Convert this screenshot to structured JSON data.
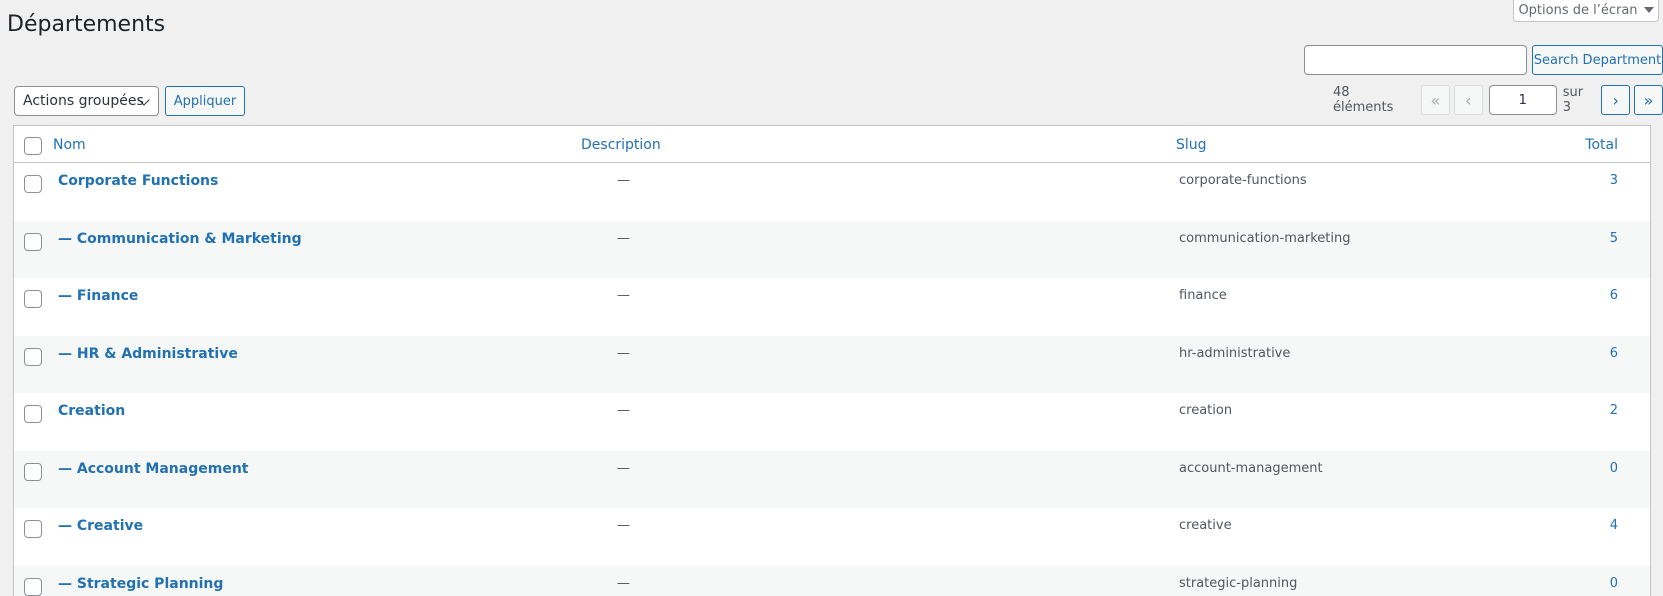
{
  "screen_options": {
    "label": "Options de l’écran"
  },
  "page": {
    "title": "Départements"
  },
  "search": {
    "value": "",
    "button_label": "Search Department"
  },
  "bulk": {
    "selected": "Actions groupées",
    "apply_label": "Appliquer"
  },
  "pagination": {
    "count_label": "48 éléments",
    "first": "«",
    "prev": "‹",
    "current_page": "1",
    "of_label": "sur 3",
    "next": "›",
    "last": "»"
  },
  "table": {
    "headers": {
      "name": "Nom",
      "description": "Description",
      "slug": "Slug",
      "total": "Total"
    },
    "rows": [
      {
        "name": "Corporate Functions",
        "description": "—",
        "slug": "corporate-functions",
        "total": "3"
      },
      {
        "name": "— Communication & Marketing",
        "description": "—",
        "slug": "communication-marketing",
        "total": "5"
      },
      {
        "name": "— Finance",
        "description": "—",
        "slug": "finance",
        "total": "6"
      },
      {
        "name": "— HR & Administrative",
        "description": "—",
        "slug": "hr-administrative",
        "total": "6"
      },
      {
        "name": "Creation",
        "description": "—",
        "slug": "creation",
        "total": "2"
      },
      {
        "name": "— Account Management",
        "description": "—",
        "slug": "account-management",
        "total": "0"
      },
      {
        "name": "— Creative",
        "description": "—",
        "slug": "creative",
        "total": "4"
      },
      {
        "name": "— Strategic Planning",
        "description": "—",
        "slug": "strategic-planning",
        "total": "0"
      }
    ]
  },
  "colors": {
    "link": "#2271b1",
    "background": "#f0f0f1",
    "alt_row": "#f6f7f7"
  }
}
